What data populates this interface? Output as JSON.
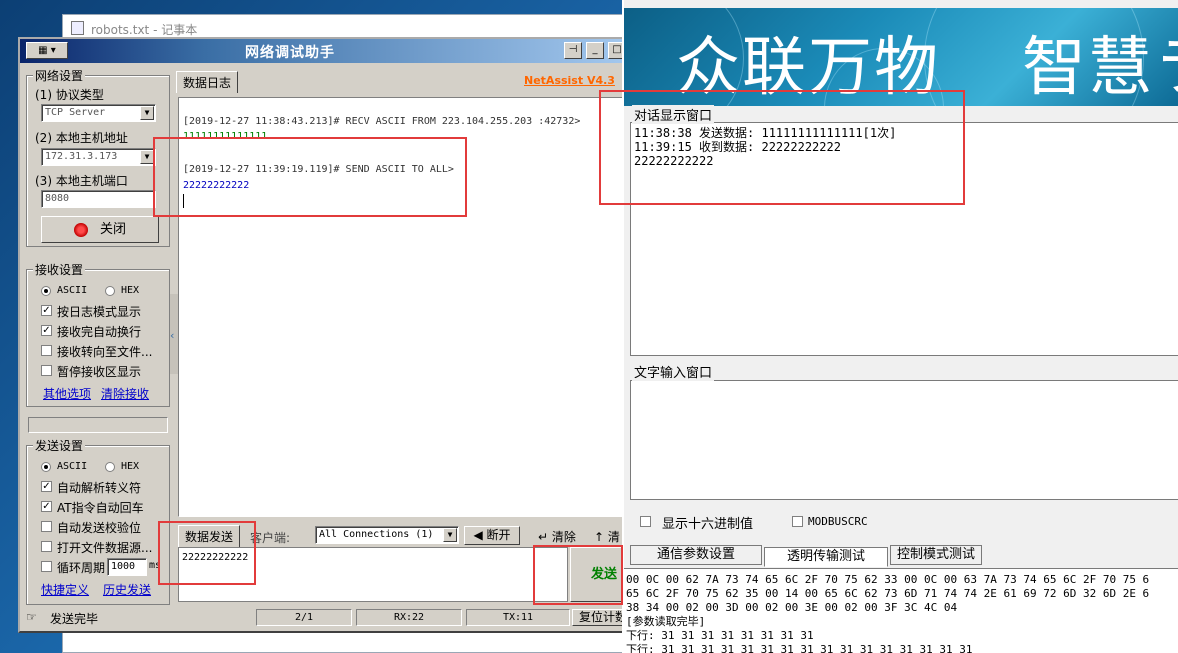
{
  "notepad": {
    "title": "robots.txt - 记事本"
  },
  "netassist": {
    "title": "网络调试助手",
    "sysmenu": "▾",
    "brand": "NetAssist V4.3",
    "net_settings": {
      "group_label": "网络设置",
      "protocol_label": "(1) 协议类型",
      "protocol_value": "TCP Server",
      "host_label": "(2) 本地主机地址",
      "host_value": "172.31.3.173",
      "port_label": "(3) 本地主机端口",
      "port_value": "8080",
      "close_button": "关闭"
    },
    "recv_settings": {
      "group_label": "接收设置",
      "ascii": "ASCII",
      "hex": "HEX",
      "opt1": "按日志模式显示",
      "opt2": "接收完自动换行",
      "opt3": "接收转向至文件...",
      "opt4": "暂停接收区显示",
      "link_more": "其他选项",
      "link_clear": "清除接收"
    },
    "send_settings": {
      "group_label": "发送设置",
      "ascii": "ASCII",
      "hex": "HEX",
      "opt1": "自动解析转义符",
      "opt2": "AT指令自动回车",
      "opt3": "自动发送校验位",
      "opt4": "打开文件数据源...",
      "opt5": "循环周期",
      "period_value": "1000",
      "period_unit": "ms",
      "link_shortcut": "快捷定义",
      "link_history": "历史发送"
    },
    "log_tab": "数据日志",
    "log": {
      "entry1_head": "[2019-12-27 11:38:43.213]# RECV ASCII FROM 223.104.255.203 :42732>",
      "entry1_body": "11111111111111",
      "entry2_head": "[2019-12-27 11:39:19.119]# SEND ASCII TO ALL>",
      "entry2_body": "22222222222"
    },
    "send_tab": "数据发送",
    "client_label": "客户端:",
    "connections_value": "All Connections (1)",
    "disconnect_button": "断开",
    "clear_button": "清除",
    "clear2_button": "清",
    "send_text": "22222222222",
    "send_button": "发送",
    "status": {
      "message": "发送完毕",
      "count": "2/1",
      "rx": "RX:22",
      "tx": "TX:11",
      "reset": "复位计数"
    }
  },
  "right_window": {
    "banner_text1": "众联万物",
    "banner_text2": "智慧ラ",
    "dialog_label": "对话显示窗口",
    "dialog_lines": [
      "11:38:38 发送数据: 11111111111111[1次]",
      "11:39:15 收到数据: 22222222222",
      "22222222222"
    ],
    "input_label": "文字输入窗口",
    "hex_checkbox": "显示十六进制值",
    "modbus_checkbox": "MODBUSCRC",
    "tabs": [
      "通信参数设置",
      "透明传输测试",
      "控制模式测试"
    ],
    "hex_lines": [
      "00 0C 00 62 7A 73 74 65 6C 2F 70 75 62 33 00 0C 00 63 7A 73 74 65 6C 2F 70 75 6",
      "65 6C 2F 70 75 62 35 00 14 00 65 6C 62 73 6D 71 74 74 2E 61 69 72 6D 32 6D 2E 6",
      "38 34 00 02 00 3D 00 02 00 3E 00 02 00 3F 3C 4C 04",
      "[参数读取完毕]",
      "下行: 31 31 31 31 31 31 31 31",
      "下行: 31 31 31 31 31 31 31 31 31 31 31 31 31 31 31 31"
    ]
  }
}
